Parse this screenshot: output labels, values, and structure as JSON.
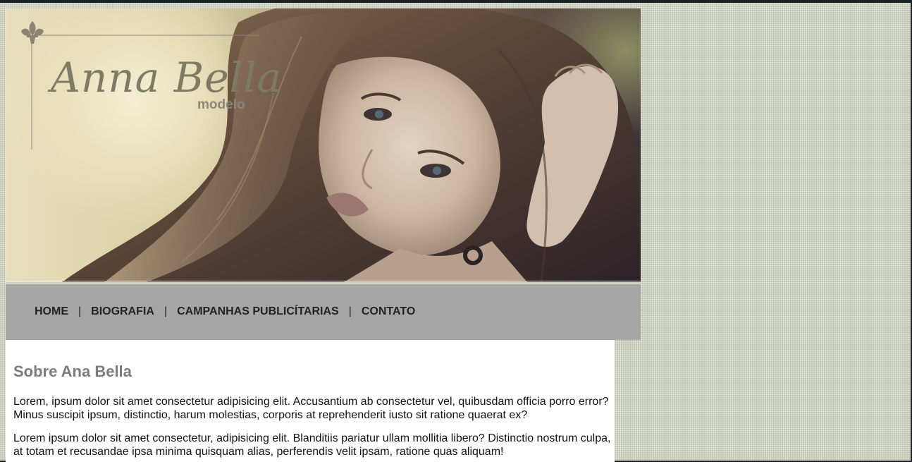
{
  "header": {
    "logo_title": "Anna Bella",
    "logo_subtitle": "modelo",
    "banner_alt": "Retrato de modelo com cabelos castanhos longos"
  },
  "nav": {
    "items": [
      {
        "label": "HOME"
      },
      {
        "label": "BIOGRAFIA"
      },
      {
        "label": "CAMPANHAS PUBLICÍTARIAS"
      },
      {
        "label": "CONTATO"
      }
    ],
    "separator": "|"
  },
  "main": {
    "title": "Sobre Ana Bella",
    "paragraphs": [
      "Lorem, ipsum dolor sit amet consectetur adipisicing elit. Accusantium ab consectetur vel, quibusdam officia porro error? Minus suscipit ipsum, distinctio, harum molestias, corporis at reprehenderit iusto sit ratione quaerat ex?",
      "Lorem ipsum dolor sit amet consectetur, adipisicing elit. Blanditiis pariatur ullam mollitia libero? Distinctio nostrum culpa, at totam et recusandae ipsa minima quisquam alias, perferendis velit ipsam, ratione quas aliquam!"
    ]
  },
  "colors": {
    "page_background": "#cfd2c2",
    "nav_background": "#a6a6a6",
    "title_gray": "#7c7c7c",
    "logo_color": "#7d7a66"
  },
  "icons": {
    "logo_ornament": "fleur-de-lis-icon"
  }
}
